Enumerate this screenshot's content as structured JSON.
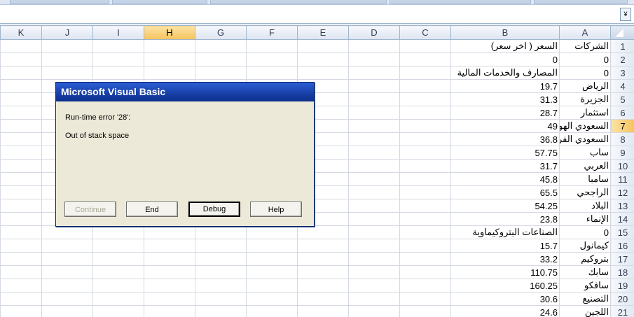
{
  "colors": {
    "accent": "#0d2f8c",
    "selected_header": "#f7c35c",
    "grid_line": "#d4d9e2"
  },
  "formula_bar": {
    "expand_icon": "chevron-down-icon",
    "expand_glyph": "¥"
  },
  "columns": [
    "K",
    "J",
    "I",
    "H",
    "G",
    "F",
    "E",
    "D",
    "C",
    "B",
    "A"
  ],
  "selected_column": "H",
  "selected_row": 7,
  "rows": [
    {
      "n": "1",
      "b": "السعر ( اخر سعر)",
      "a": "الشركات"
    },
    {
      "n": "2",
      "b": "0",
      "a": "0"
    },
    {
      "n": "3",
      "b": "المصارف والخدمات المالية",
      "a": "0"
    },
    {
      "n": "4",
      "b": "19.7",
      "a": "الرياض"
    },
    {
      "n": "5",
      "b": "31.3",
      "a": "الجزيرة"
    },
    {
      "n": "6",
      "b": "28.7",
      "a": "استثمار"
    },
    {
      "n": "7",
      "b": "49",
      "a": "السعودي الهولن"
    },
    {
      "n": "8",
      "b": "36.8",
      "a": "السعودي الفرنس"
    },
    {
      "n": "9",
      "b": "57.75",
      "a": "ساب"
    },
    {
      "n": "10",
      "b": "31.7",
      "a": "العربي"
    },
    {
      "n": "11",
      "b": "45.8",
      "a": "سامبا"
    },
    {
      "n": "12",
      "b": "65.5",
      "a": "الراجحي"
    },
    {
      "n": "13",
      "b": "54.25",
      "a": "البلاد"
    },
    {
      "n": "14",
      "b": "23.8",
      "a": "الإنماء"
    },
    {
      "n": "15",
      "b": "الصناعات البتروكيماوية",
      "a": "0"
    },
    {
      "n": "16",
      "b": "15.7",
      "a": "كيمانول"
    },
    {
      "n": "17",
      "b": "33.2",
      "a": "بتروكيم"
    },
    {
      "n": "18",
      "b": "110.75",
      "a": "سابك"
    },
    {
      "n": "19",
      "b": "160.25",
      "a": "سافكو"
    },
    {
      "n": "20",
      "b": "30.6",
      "a": "التصنيع"
    },
    {
      "n": "21",
      "b": "24.6",
      "a": "اللجين"
    }
  ],
  "dialog": {
    "title": "Microsoft Visual Basic",
    "error_line": "Run-time error '28':",
    "message": "Out of stack space",
    "buttons": {
      "continue": "Continue",
      "end": "End",
      "debug": "Debug",
      "help": "Help"
    }
  }
}
